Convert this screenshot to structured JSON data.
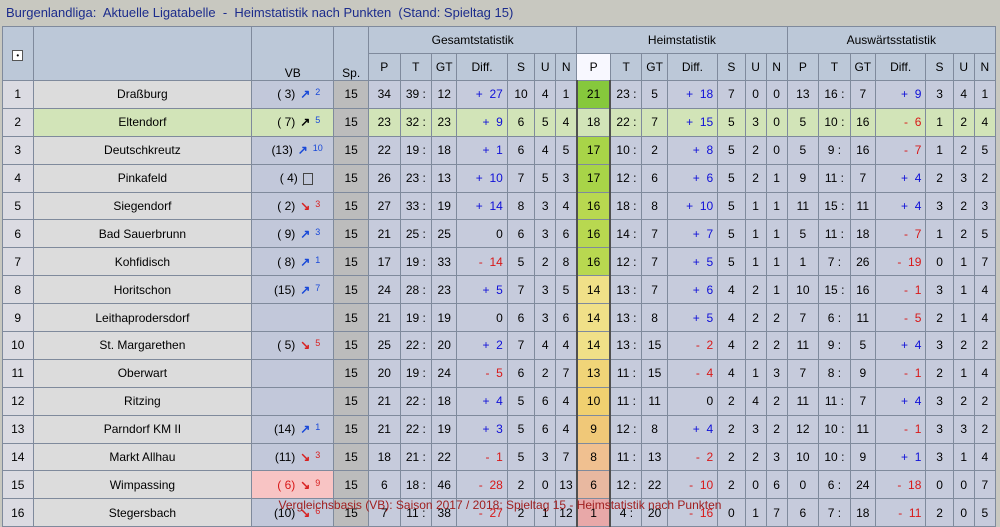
{
  "title": "Burgenlandliga:  Aktuelle Ligatabelle  -  Heimstatistik nach Punkten  (Stand: Spieltag 15)",
  "footer": "Vergleichsbasis (VB): Saison 2017 / 2018: Spieltag 15 - Heimstatistik nach Punkten",
  "headers": {
    "vb": "VB",
    "sp": "Sp.",
    "gesamt": "Gesamtstatistik",
    "heim": "Heimstatistik",
    "auswaerts": "Auswärtsstatistik",
    "p": "P",
    "t": "T",
    "gt": "GT",
    "diff": "Diff.",
    "s": "S",
    "u": "U",
    "n": "N"
  },
  "rows": [
    {
      "rank": "1",
      "team": "Draßburg",
      "vb": "( 3)",
      "arrow": "up",
      "move": "2",
      "sp": "15",
      "g": {
        "p": "34",
        "t": "39",
        "gt": "12",
        "sign": "+",
        "diff": "27",
        "s": "10",
        "u": "4",
        "n": "1"
      },
      "h": {
        "p": "21",
        "t": "23",
        "gt": "5",
        "sign": "+",
        "diff": "18",
        "s": "7",
        "u": "0",
        "n": "0"
      },
      "a": {
        "p": "13",
        "t": "16",
        "gt": "7",
        "sign": "+",
        "diff": "9",
        "s": "3",
        "u": "4",
        "n": "1"
      },
      "pcolor": "#86c83c"
    },
    {
      "rank": "2",
      "team": "Eltendorf",
      "vb": "( 7)",
      "arrow": "up",
      "move": "5",
      "sp": "15",
      "g": {
        "p": "23",
        "t": "32",
        "gt": "23",
        "sign": "+",
        "diff": "9",
        "s": "6",
        "u": "5",
        "n": "4"
      },
      "h": {
        "p": "18",
        "t": "22",
        "gt": "7",
        "sign": "+",
        "diff": "15",
        "s": "5",
        "u": "3",
        "n": "0"
      },
      "a": {
        "p": "5",
        "t": "10",
        "gt": "16",
        "sign": "-",
        "diff": "6",
        "s": "1",
        "u": "2",
        "n": "4"
      },
      "pcolor": "#d2e4b8"
    },
    {
      "rank": "3",
      "team": "Deutschkreutz",
      "vb": "(13)",
      "arrow": "up",
      "move": "10",
      "sp": "15",
      "g": {
        "p": "22",
        "t": "19",
        "gt": "18",
        "sign": "+",
        "diff": "1",
        "s": "6",
        "u": "4",
        "n": "5"
      },
      "h": {
        "p": "17",
        "t": "10",
        "gt": "2",
        "sign": "+",
        "diff": "8",
        "s": "5",
        "u": "2",
        "n": "0"
      },
      "a": {
        "p": "5",
        "t": "9",
        "gt": "16",
        "sign": "-",
        "diff": "7",
        "s": "1",
        "u": "2",
        "n": "5"
      },
      "pcolor": "#a8d448"
    },
    {
      "rank": "4",
      "team": "Pinkafeld",
      "vb": "( 4)",
      "arrow": "eq",
      "move": "",
      "sp": "15",
      "g": {
        "p": "26",
        "t": "23",
        "gt": "13",
        "sign": "+",
        "diff": "10",
        "s": "7",
        "u": "5",
        "n": "3"
      },
      "h": {
        "p": "17",
        "t": "12",
        "gt": "6",
        "sign": "+",
        "diff": "6",
        "s": "5",
        "u": "2",
        "n": "1"
      },
      "a": {
        "p": "9",
        "t": "11",
        "gt": "7",
        "sign": "+",
        "diff": "4",
        "s": "2",
        "u": "3",
        "n": "2"
      },
      "pcolor": "#a8d448"
    },
    {
      "rank": "5",
      "team": "Siegendorf",
      "vb": "( 2)",
      "arrow": "dn",
      "move": "3",
      "sp": "15",
      "g": {
        "p": "27",
        "t": "33",
        "gt": "19",
        "sign": "+",
        "diff": "14",
        "s": "8",
        "u": "3",
        "n": "4"
      },
      "h": {
        "p": "16",
        "t": "18",
        "gt": "8",
        "sign": "+",
        "diff": "10",
        "s": "5",
        "u": "1",
        "n": "1"
      },
      "a": {
        "p": "11",
        "t": "15",
        "gt": "11",
        "sign": "+",
        "diff": "4",
        "s": "3",
        "u": "2",
        "n": "3"
      },
      "pcolor": "#b8d850"
    },
    {
      "rank": "6",
      "team": "Bad Sauerbrunn",
      "vb": "( 9)",
      "arrow": "up",
      "move": "3",
      "sp": "15",
      "g": {
        "p": "21",
        "t": "25",
        "gt": "25",
        "sign": "",
        "diff": "0",
        "s": "6",
        "u": "3",
        "n": "6"
      },
      "h": {
        "p": "16",
        "t": "14",
        "gt": "7",
        "sign": "+",
        "diff": "7",
        "s": "5",
        "u": "1",
        "n": "1"
      },
      "a": {
        "p": "5",
        "t": "11",
        "gt": "18",
        "sign": "-",
        "diff": "7",
        "s": "1",
        "u": "2",
        "n": "5"
      },
      "pcolor": "#b8d850"
    },
    {
      "rank": "7",
      "team": "Kohfidisch",
      "vb": "( 8)",
      "arrow": "up",
      "move": "1",
      "sp": "15",
      "g": {
        "p": "17",
        "t": "19",
        "gt": "33",
        "sign": "-",
        "diff": "14",
        "s": "5",
        "u": "2",
        "n": "8"
      },
      "h": {
        "p": "16",
        "t": "12",
        "gt": "7",
        "sign": "+",
        "diff": "5",
        "s": "5",
        "u": "1",
        "n": "1"
      },
      "a": {
        "p": "1",
        "t": "7",
        "gt": "26",
        "sign": "-",
        "diff": "19",
        "s": "0",
        "u": "1",
        "n": "7"
      },
      "pcolor": "#b8d850"
    },
    {
      "rank": "8",
      "team": "Horitschon",
      "vb": "(15)",
      "arrow": "up",
      "move": "7",
      "sp": "15",
      "g": {
        "p": "24",
        "t": "28",
        "gt": "23",
        "sign": "+",
        "diff": "5",
        "s": "7",
        "u": "3",
        "n": "5"
      },
      "h": {
        "p": "14",
        "t": "13",
        "gt": "7",
        "sign": "+",
        "diff": "6",
        "s": "4",
        "u": "2",
        "n": "1"
      },
      "a": {
        "p": "10",
        "t": "15",
        "gt": "16",
        "sign": "-",
        "diff": "1",
        "s": "3",
        "u": "1",
        "n": "4"
      },
      "pcolor": "#f0e088"
    },
    {
      "rank": "9",
      "team": "Leithaprodersdorf",
      "vb": "",
      "arrow": "",
      "move": "",
      "sp": "15",
      "g": {
        "p": "21",
        "t": "19",
        "gt": "19",
        "sign": "",
        "diff": "0",
        "s": "6",
        "u": "3",
        "n": "6"
      },
      "h": {
        "p": "14",
        "t": "13",
        "gt": "8",
        "sign": "+",
        "diff": "5",
        "s": "4",
        "u": "2",
        "n": "2"
      },
      "a": {
        "p": "7",
        "t": "6",
        "gt": "11",
        "sign": "-",
        "diff": "5",
        "s": "2",
        "u": "1",
        "n": "4"
      },
      "pcolor": "#f0e088"
    },
    {
      "rank": "10",
      "team": "St. Margarethen",
      "vb": "( 5)",
      "arrow": "dn",
      "move": "5",
      "sp": "15",
      "g": {
        "p": "25",
        "t": "22",
        "gt": "20",
        "sign": "+",
        "diff": "2",
        "s": "7",
        "u": "4",
        "n": "4"
      },
      "h": {
        "p": "14",
        "t": "13",
        "gt": "15",
        "sign": "-",
        "diff": "2",
        "s": "4",
        "u": "2",
        "n": "2"
      },
      "a": {
        "p": "11",
        "t": "9",
        "gt": "5",
        "sign": "+",
        "diff": "4",
        "s": "3",
        "u": "2",
        "n": "2"
      },
      "pcolor": "#f0e088"
    },
    {
      "rank": "11",
      "team": "Oberwart",
      "vb": "",
      "arrow": "",
      "move": "",
      "sp": "15",
      "g": {
        "p": "20",
        "t": "19",
        "gt": "24",
        "sign": "-",
        "diff": "5",
        "s": "6",
        "u": "2",
        "n": "7"
      },
      "h": {
        "p": "13",
        "t": "11",
        "gt": "15",
        "sign": "-",
        "diff": "4",
        "s": "4",
        "u": "1",
        "n": "3"
      },
      "a": {
        "p": "7",
        "t": "8",
        "gt": "9",
        "sign": "-",
        "diff": "1",
        "s": "2",
        "u": "1",
        "n": "4"
      },
      "pcolor": "#f0d478"
    },
    {
      "rank": "12",
      "team": "Ritzing",
      "vb": "",
      "arrow": "",
      "move": "",
      "sp": "15",
      "g": {
        "p": "21",
        "t": "22",
        "gt": "18",
        "sign": "+",
        "diff": "4",
        "s": "5",
        "u": "6",
        "n": "4"
      },
      "h": {
        "p": "10",
        "t": "11",
        "gt": "11",
        "sign": "",
        "diff": "0",
        "s": "2",
        "u": "4",
        "n": "2"
      },
      "a": {
        "p": "11",
        "t": "11",
        "gt": "7",
        "sign": "+",
        "diff": "4",
        "s": "3",
        "u": "2",
        "n": "2"
      },
      "pcolor": "#f0d070"
    },
    {
      "rank": "13",
      "team": "Parndorf KM II",
      "vb": "(14)",
      "arrow": "up",
      "move": "1",
      "sp": "15",
      "g": {
        "p": "21",
        "t": "22",
        "gt": "19",
        "sign": "+",
        "diff": "3",
        "s": "5",
        "u": "6",
        "n": "4"
      },
      "h": {
        "p": "9",
        "t": "12",
        "gt": "8",
        "sign": "+",
        "diff": "4",
        "s": "2",
        "u": "3",
        "n": "2"
      },
      "a": {
        "p": "12",
        "t": "10",
        "gt": "11",
        "sign": "-",
        "diff": "1",
        "s": "3",
        "u": "3",
        "n": "2"
      },
      "pcolor": "#f0c878"
    },
    {
      "rank": "14",
      "team": "Markt Allhau",
      "vb": "(11)",
      "arrow": "dn",
      "move": "3",
      "sp": "15",
      "g": {
        "p": "18",
        "t": "21",
        "gt": "22",
        "sign": "-",
        "diff": "1",
        "s": "5",
        "u": "3",
        "n": "7"
      },
      "h": {
        "p": "8",
        "t": "11",
        "gt": "13",
        "sign": "-",
        "diff": "2",
        "s": "2",
        "u": "2",
        "n": "3"
      },
      "a": {
        "p": "10",
        "t": "10",
        "gt": "9",
        "sign": "+",
        "diff": "1",
        "s": "3",
        "u": "1",
        "n": "4"
      },
      "pcolor": "#f0c090"
    },
    {
      "rank": "15",
      "team": "Wimpassing",
      "vb": "( 6)",
      "arrow": "dn",
      "move": "9",
      "sp": "15",
      "g": {
        "p": "6",
        "t": "18",
        "gt": "46",
        "sign": "-",
        "diff": "28",
        "s": "2",
        "u": "0",
        "n": "13"
      },
      "h": {
        "p": "6",
        "t": "12",
        "gt": "22",
        "sign": "-",
        "diff": "10",
        "s": "2",
        "u": "0",
        "n": "6"
      },
      "a": {
        "p": "0",
        "t": "6",
        "gt": "24",
        "sign": "-",
        "diff": "18",
        "s": "0",
        "u": "0",
        "n": "7"
      },
      "pcolor": "#e8b8a0"
    },
    {
      "rank": "16",
      "team": "Stegersbach",
      "vb": "(10)",
      "arrow": "dn",
      "move": "6",
      "sp": "15",
      "g": {
        "p": "7",
        "t": "11",
        "gt": "38",
        "sign": "-",
        "diff": "27",
        "s": "2",
        "u": "1",
        "n": "12"
      },
      "h": {
        "p": "1",
        "t": "4",
        "gt": "20",
        "sign": "-",
        "diff": "16",
        "s": "0",
        "u": "1",
        "n": "7"
      },
      "a": {
        "p": "6",
        "t": "7",
        "gt": "18",
        "sign": "-",
        "diff": "11",
        "s": "2",
        "u": "0",
        "n": "5"
      },
      "pcolor": "#e8a8a8"
    }
  ]
}
